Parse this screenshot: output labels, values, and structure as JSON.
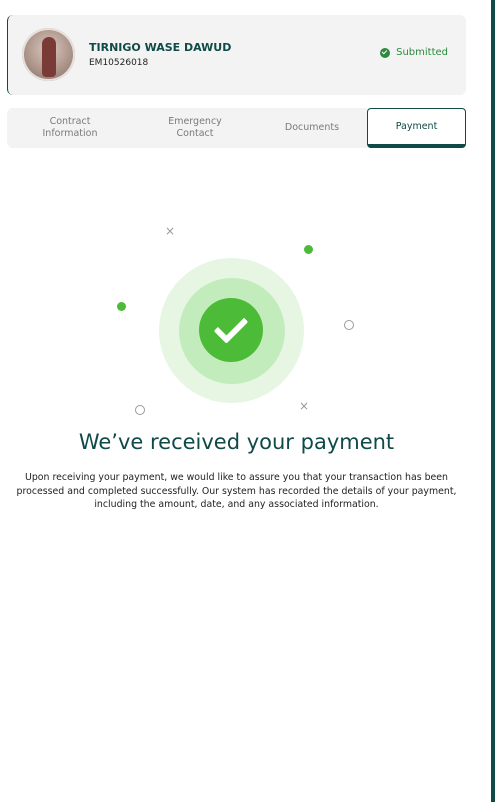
{
  "profile": {
    "name": "TIRNIGO WASE DAWUD",
    "employee_id": "EM10526018",
    "status": "Submitted",
    "avatar_icon": "user-photo"
  },
  "tabs": [
    {
      "label": "Contract\nInformation",
      "active": false
    },
    {
      "label": "Emergency\nContact",
      "active": false
    },
    {
      "label": "Documents",
      "active": false
    },
    {
      "label": "Payment",
      "active": true
    }
  ],
  "confirmation": {
    "headline": "We’ve received your payment",
    "message": "Upon receiving your payment, we would like to assure you that your transaction has been processed and completed successfully. Our system has recorded the details of your payment, including the amount, date, and any associated information.",
    "icon": "check-circle-icon"
  },
  "colors": {
    "primary": "#0f4a47",
    "success": "#4cbb37",
    "status_text": "#2b8a3e"
  }
}
